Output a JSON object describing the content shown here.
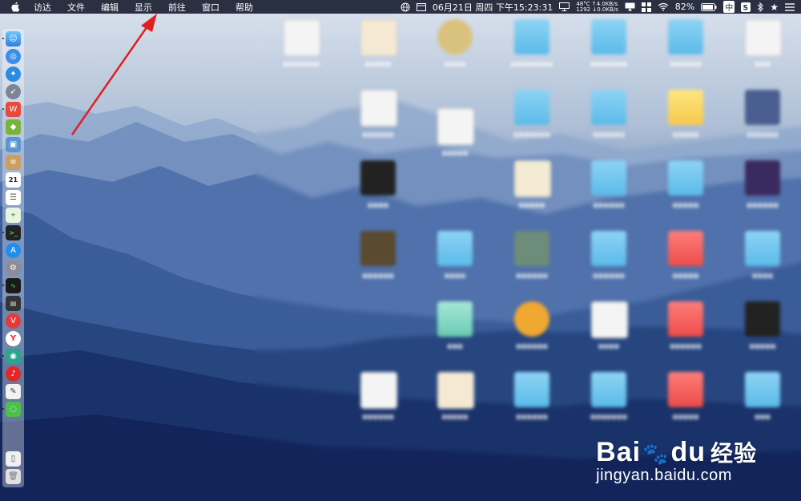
{
  "menubar": {
    "apple_icon": "apple-icon",
    "items": [
      "访达",
      "文件",
      "编辑",
      "显示",
      "前往",
      "窗口",
      "帮助"
    ],
    "status": {
      "date_time": "06月21日 周四 下午15:23:31",
      "temp": "48°C",
      "net_up": "↑4.0KB/s",
      "net_down": "↓0.0KB/s",
      "net_prefix": "1292",
      "battery": "82%",
      "input_method": "中"
    }
  },
  "dock": {
    "items": [
      "finder",
      "safari-alt",
      "safari",
      "launchpad",
      "wps",
      "android",
      "preview",
      "notes",
      "calendar",
      "reminders",
      "maps",
      "terminal",
      "app-store",
      "system-preferences",
      "activity-monitor",
      "console",
      "vivaldi",
      "yandex",
      "chromium",
      "netease-music",
      "script-editor",
      "wechat",
      "documents",
      "trash"
    ],
    "calendar_day": "21"
  },
  "watermark": {
    "brand_left": "Bai",
    "brand_paw": "🐾",
    "brand_right": "du",
    "brand_jy": "经验",
    "url": "jingyan.baidu.com"
  },
  "colors": {
    "menubar_bg": "#2a3042",
    "arrow": "#e02020",
    "folder_blue": "#5bbbe9",
    "folder_red": "#ec4c4a"
  }
}
